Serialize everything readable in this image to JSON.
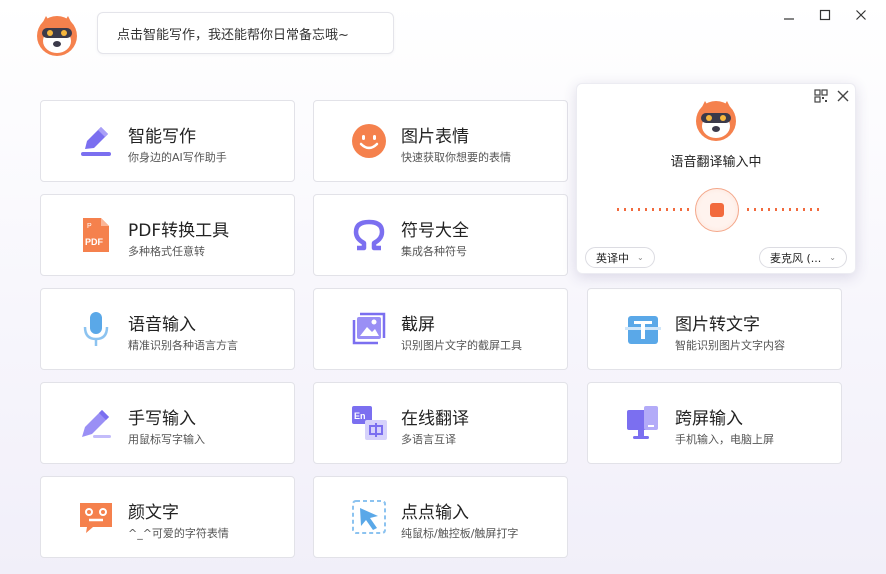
{
  "header": {
    "bubble_text": "点击智能写作，我还能帮你日常备忘哦~"
  },
  "window": {
    "minimize": "minimize",
    "maximize": "maximize",
    "close": "close"
  },
  "tools": [
    {
      "title": "智能写作",
      "subtitle": "你身边的AI写作助手",
      "icon": "pen-writing-icon"
    },
    {
      "title": "图片表情",
      "subtitle": "快速获取你想要的表情",
      "icon": "smiley-icon"
    },
    {
      "title": "PDF转换工具",
      "subtitle": "多种格式任意转",
      "icon": "pdf-icon"
    },
    {
      "title": "符号大全",
      "subtitle": "集成各种符号",
      "icon": "omega-icon"
    },
    {
      "title": "语音输入",
      "subtitle": "精准识别各种语言方言",
      "icon": "microphone-icon"
    },
    {
      "title": "截屏",
      "subtitle": "识别图片文字的截屏工具",
      "icon": "screenshot-icon"
    },
    {
      "title": "图片转文字",
      "subtitle": "智能识别图片文字内容",
      "icon": "image-to-text-icon"
    },
    {
      "title": "手写输入",
      "subtitle": "用鼠标写字输入",
      "icon": "handwriting-pen-icon"
    },
    {
      "title": "在线翻译",
      "subtitle": "多语言互译",
      "icon": "translate-icon"
    },
    {
      "title": "跨屏输入",
      "subtitle": "手机输入，电脑上屏",
      "icon": "cross-screen-icon"
    },
    {
      "title": "颜文字",
      "subtitle": "^_^可爱的字符表情",
      "icon": "kaomoji-icon"
    },
    {
      "title": "点点输入",
      "subtitle": "纯鼠标/触控板/触屏打字",
      "icon": "pointer-click-icon"
    }
  ],
  "voice_panel": {
    "status": "语音翻译输入中",
    "mode_select": "英译中",
    "mic_select": "麦克风 (...",
    "colors": {
      "accent": "#f26a3d"
    }
  },
  "colors": {
    "orange": "#f5814d",
    "purple": "#7b6ff0",
    "blue": "#5aa8e8"
  }
}
